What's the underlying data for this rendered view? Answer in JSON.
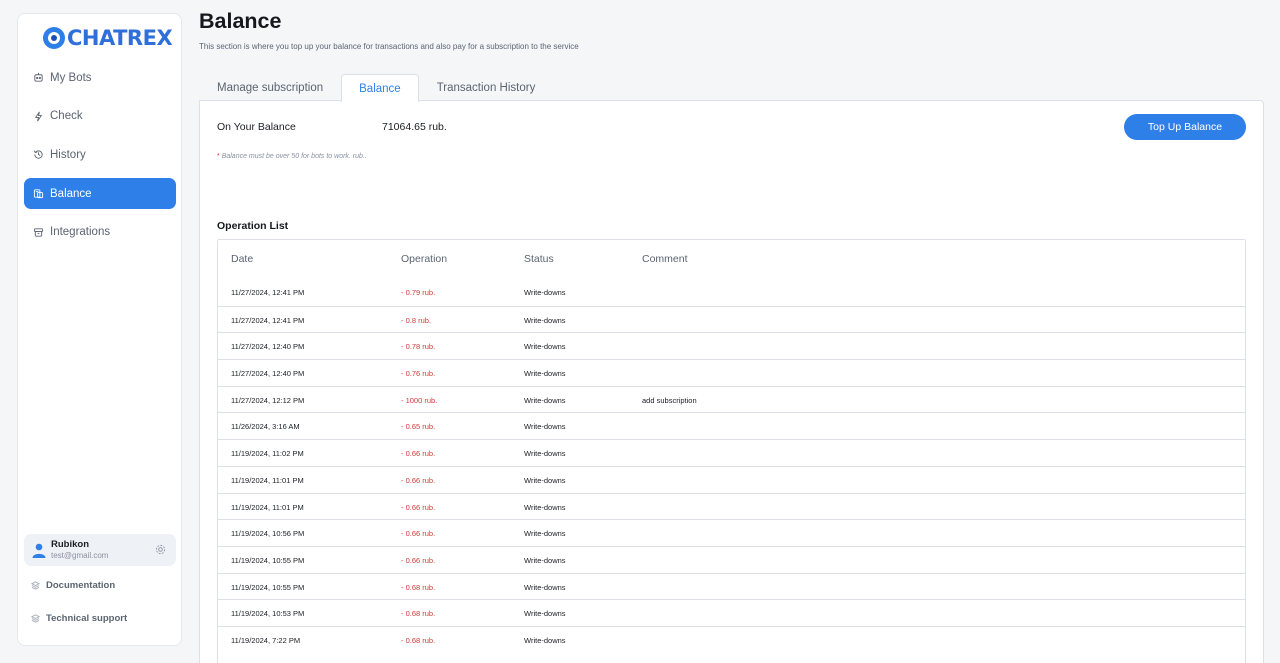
{
  "brand": {
    "name": "CHATREX"
  },
  "sidebar": {
    "items": [
      {
        "label": "My Bots",
        "icon": "bots-icon",
        "active": false
      },
      {
        "label": "Check",
        "icon": "lightning-icon",
        "active": false
      },
      {
        "label": "History",
        "icon": "history-icon",
        "active": false
      },
      {
        "label": "Balance",
        "icon": "wallet-icon",
        "active": true
      },
      {
        "label": "Integrations",
        "icon": "integrations-icon",
        "active": false
      }
    ],
    "user": {
      "name": "Rubikon",
      "email": "test@gmail.com"
    },
    "links": {
      "documentation": "Documentation",
      "support": "Technical support"
    }
  },
  "page": {
    "title": "Balance",
    "description": "This section is where you top up your balance for transactions and also pay for a subscription to the service"
  },
  "tabs": [
    {
      "label": "Manage subscription",
      "active": false
    },
    {
      "label": "Balance",
      "active": true
    },
    {
      "label": "Transaction History",
      "active": false
    }
  ],
  "balance": {
    "label": "On Your Balance",
    "value": "71064.65 rub.",
    "button": "Top Up Balance",
    "note": "Balance must be over 50 for bots to work. rub..",
    "note_star": "*"
  },
  "operations": {
    "title": "Operation List",
    "columns": {
      "date": "Date",
      "operation": "Operation",
      "status": "Status",
      "comment": "Comment"
    },
    "rows": [
      {
        "date": "11/27/2024, 12:41 PM",
        "operation": "- 0.79 rub.",
        "status": "Write-downs",
        "comment": ""
      },
      {
        "date": "11/27/2024, 12:41 PM",
        "operation": "- 0.8 rub.",
        "status": "Write-downs",
        "comment": ""
      },
      {
        "date": "11/27/2024, 12:40 PM",
        "operation": "- 0.78 rub.",
        "status": "Write-downs",
        "comment": ""
      },
      {
        "date": "11/27/2024, 12:40 PM",
        "operation": "- 0.76 rub.",
        "status": "Write-downs",
        "comment": ""
      },
      {
        "date": "11/27/2024, 12:12 PM",
        "operation": "- 1000 rub.",
        "status": "Write-downs",
        "comment": "add subscription"
      },
      {
        "date": "11/26/2024, 3:16 AM",
        "operation": "- 0.65 rub.",
        "status": "Write-downs",
        "comment": ""
      },
      {
        "date": "11/19/2024, 11:02 PM",
        "operation": "- 0.66 rub.",
        "status": "Write-downs",
        "comment": ""
      },
      {
        "date": "11/19/2024, 11:01 PM",
        "operation": "- 0.66 rub.",
        "status": "Write-downs",
        "comment": ""
      },
      {
        "date": "11/19/2024, 11:01 PM",
        "operation": "- 0.66 rub.",
        "status": "Write-downs",
        "comment": ""
      },
      {
        "date": "11/19/2024, 10:56 PM",
        "operation": "- 0.66 rub.",
        "status": "Write-downs",
        "comment": ""
      },
      {
        "date": "11/19/2024, 10:55 PM",
        "operation": "- 0.66 rub.",
        "status": "Write-downs",
        "comment": ""
      },
      {
        "date": "11/19/2024, 10:55 PM",
        "operation": "- 0.68 rub.",
        "status": "Write-downs",
        "comment": ""
      },
      {
        "date": "11/19/2024, 10:53 PM",
        "operation": "- 0.68 rub.",
        "status": "Write-downs",
        "comment": ""
      },
      {
        "date": "11/19/2024, 7:22 PM",
        "operation": "- 0.68 rub.",
        "status": "Write-downs",
        "comment": ""
      }
    ]
  }
}
